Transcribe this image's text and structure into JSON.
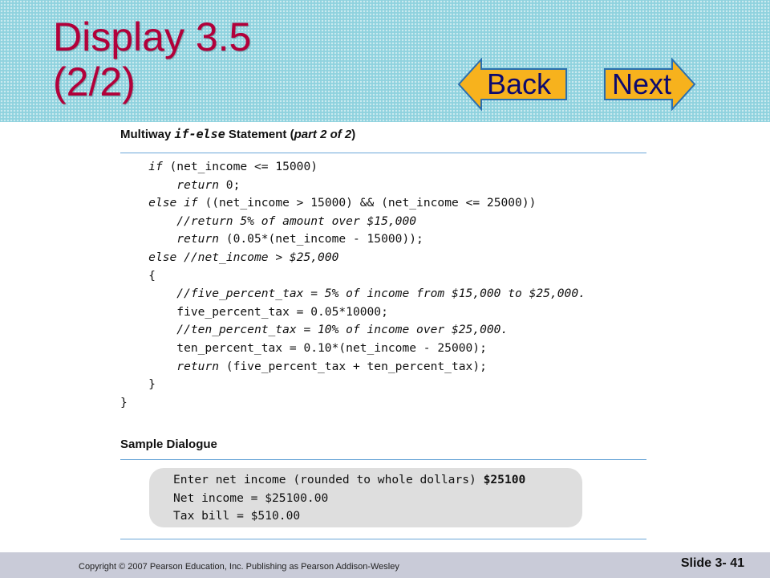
{
  "slide": {
    "title": "Display 3.5\n(2/2)",
    "nav": {
      "back_label": "Back",
      "next_label": "Next"
    },
    "colors": {
      "title": "#b2003a",
      "header_bg": "#8fd2de",
      "arrow_fill": "#f7b21d",
      "arrow_outline": "#2a6fb0",
      "rule": "#6aa6d8"
    }
  },
  "display": {
    "caption_prefix": "Multiway ",
    "caption_code": "if-else",
    "caption_mid": " Statement (",
    "caption_part": "part 2 of 2",
    "caption_suffix": ")",
    "code_lines": [
      [
        {
          "t": "    "
        },
        {
          "t": "if",
          "c": "kw"
        },
        {
          "t": " (net_income <= 15000)"
        }
      ],
      [
        {
          "t": "        "
        },
        {
          "t": "return",
          "c": "kw"
        },
        {
          "t": " 0;"
        }
      ],
      [
        {
          "t": "    "
        },
        {
          "t": "else if",
          "c": "kw"
        },
        {
          "t": " ((net_income > 15000) && (net_income <= 25000))"
        }
      ],
      [
        {
          "t": "        "
        },
        {
          "t": "//return 5% of amount over $15,000",
          "c": "cmt"
        }
      ],
      [
        {
          "t": "        "
        },
        {
          "t": "return",
          "c": "kw"
        },
        {
          "t": " (0.05*(net_income - 15000));"
        }
      ],
      [
        {
          "t": "    "
        },
        {
          "t": "else",
          "c": "kw"
        },
        {
          "t": " "
        },
        {
          "t": "//net_income > $25,000",
          "c": "cmt"
        }
      ],
      [
        {
          "t": "    {"
        }
      ],
      [
        {
          "t": "        "
        },
        {
          "t": "//five_percent_tax = 5% of income from $15,000 to $25,000.",
          "c": "cmt"
        }
      ],
      [
        {
          "t": "        five_percent_tax = 0.05*10000;"
        }
      ],
      [
        {
          "t": "        "
        },
        {
          "t": "//ten_percent_tax = 10% of income over $25,000.",
          "c": "cmt"
        }
      ],
      [
        {
          "t": "        ten_percent_tax = 0.10*(net_income - 25000);"
        }
      ],
      [
        {
          "t": "        "
        },
        {
          "t": "return",
          "c": "kw"
        },
        {
          "t": " (five_percent_tax + ten_percent_tax);"
        }
      ],
      [
        {
          "t": "    }"
        }
      ],
      [
        {
          "t": "}"
        }
      ]
    ],
    "dialogue_title": "Sample Dialogue",
    "dialogue_lines": [
      [
        {
          "t": "Enter net income (rounded to whole dollars) "
        },
        {
          "t": "$25100",
          "c": "user-input"
        }
      ],
      [
        {
          "t": "Net income = $25100.00"
        }
      ],
      [
        {
          "t": "Tax bill = $510.00"
        }
      ]
    ]
  },
  "footer": {
    "copyright": "Copyright © 2007 Pearson Education, Inc. Publishing as Pearson Addison-Wesley",
    "slide_number": "Slide 3- 41"
  }
}
